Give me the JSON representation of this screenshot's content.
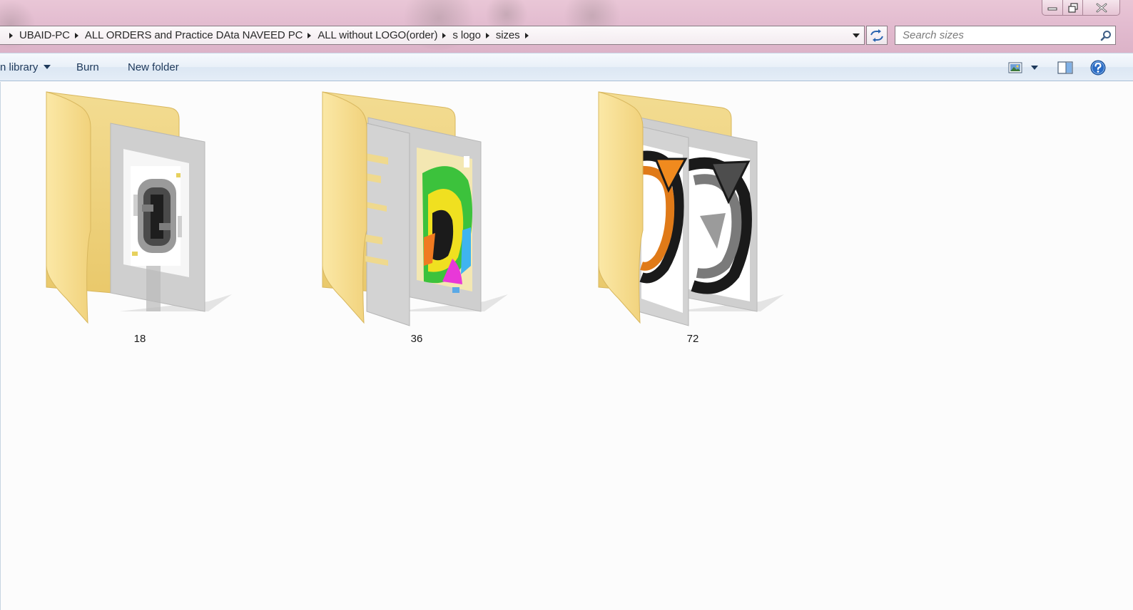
{
  "window": {
    "min_label": "",
    "max_label": "",
    "close_label": ""
  },
  "address": {
    "crumbs": [
      "UBAID-PC",
      "ALL ORDERS and Practice DAta NAVEED PC",
      "ALL without LOGO(order)",
      "s logo",
      "sizes"
    ]
  },
  "search": {
    "placeholder": "Search sizes",
    "value": ""
  },
  "toolbar": {
    "include_library_label": "n library",
    "burn_label": "Burn",
    "new_folder_label": "New folder"
  },
  "folders": [
    {
      "name": "18"
    },
    {
      "name": "36"
    },
    {
      "name": "72"
    }
  ],
  "colors": {
    "folder_yellow": "#f4d985",
    "command_text": "#1e395b",
    "titlebar_pink": "#e3bcd0"
  },
  "icons": {
    "refresh": "refresh-icon",
    "search": "search-icon",
    "views": "views-icon",
    "preview_pane": "preview-pane-icon",
    "help": "help-icon"
  }
}
